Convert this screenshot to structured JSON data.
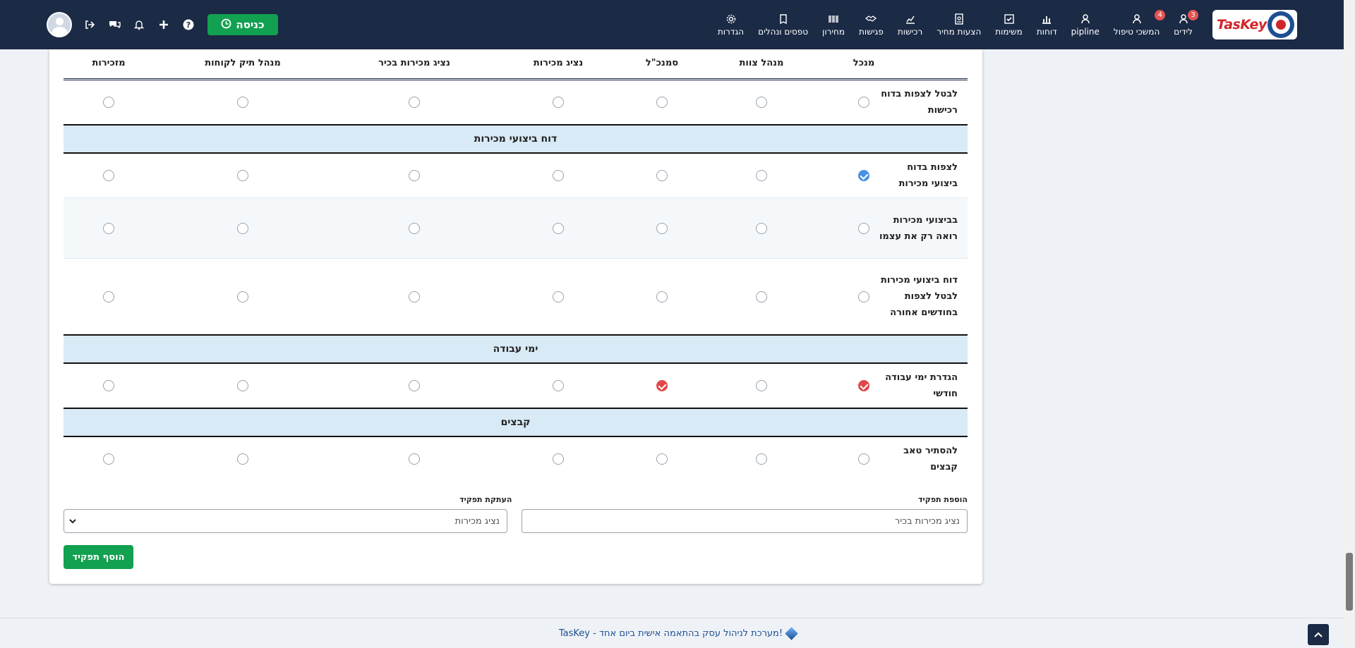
{
  "navbar": {
    "logo_text": "TasKey",
    "menu": [
      {
        "label": "לידים",
        "icon": "user-icon",
        "badge": "3"
      },
      {
        "label": "המשכי טיפול",
        "icon": "user-icon",
        "badge": "4"
      },
      {
        "label": "pipline",
        "icon": "user-icon",
        "badge": ""
      },
      {
        "label": "דוחות",
        "icon": "bar-chart-icon",
        "badge": ""
      },
      {
        "label": "משימות",
        "icon": "checkbox-icon",
        "badge": ""
      },
      {
        "label": "הצעות מחיר",
        "icon": "document-icon",
        "badge": ""
      },
      {
        "label": "רכישות",
        "icon": "purchase-chart-icon",
        "badge": ""
      },
      {
        "label": "פגישות",
        "icon": "handshake-icon",
        "badge": ""
      },
      {
        "label": "מחירון",
        "icon": "barcode-icon",
        "badge": ""
      },
      {
        "label": "טפסים ונהלים",
        "icon": "book-icon",
        "badge": ""
      },
      {
        "label": "הגדרות",
        "icon": "gear-icon",
        "badge": ""
      }
    ],
    "checkin_label": "כניסה"
  },
  "table": {
    "columns": [
      "מנכל",
      "מנהל צוות",
      "סמנכ\"ל",
      "נציג מכירות",
      "נציג מכירות בכיר",
      "מנהל תיק לקוחות",
      "מזכירות"
    ],
    "row0": {
      "label": "לבטל לצפות בדוח רכישות",
      "checked": [
        0,
        0,
        0,
        0,
        0,
        0,
        0
      ]
    },
    "sections": [
      {
        "title": "דוח ביצועי מכירות"
      },
      {
        "title": "ימי עבודה"
      },
      {
        "title": "קבצים"
      }
    ],
    "row1": {
      "label": "לצפות בדוח ביצועי מכירות"
    },
    "row2": {
      "label": "בביצועי מכירות רואה רק את עצמו"
    },
    "row3": {
      "label": "דוח ביצועי מכירות לבטל לצפות בחודשים אחורה"
    },
    "row4": {
      "label": "הגדרת ימי עבודה חודשי"
    },
    "row5": {
      "label": "להסתיר טאב קבצים"
    },
    "checked_states": {
      "row1": [
        "blue",
        "",
        "",
        "",
        "",
        "",
        ""
      ],
      "row4": [
        "red",
        "",
        "red",
        "",
        "",
        "",
        ""
      ]
    }
  },
  "form": {
    "add_role_label": "הוספת תפקיד",
    "add_role_value": "נציג מכירות בכיר",
    "copy_role_label": "העתקת תפקיד",
    "copy_role_value": "נציג מכירות",
    "submit_label": "הוסף תפקיד"
  },
  "footer": {
    "text": "TasKey - מערכת לניהול עסק בהתאמה אישית ביום אחד!"
  },
  "colors": {
    "navbar_bg": "#1b2a45",
    "success_green": "#12a150",
    "checked_blue": "#4a90e2",
    "checked_red": "#e04848",
    "section_bg": "#d8eaf5"
  }
}
